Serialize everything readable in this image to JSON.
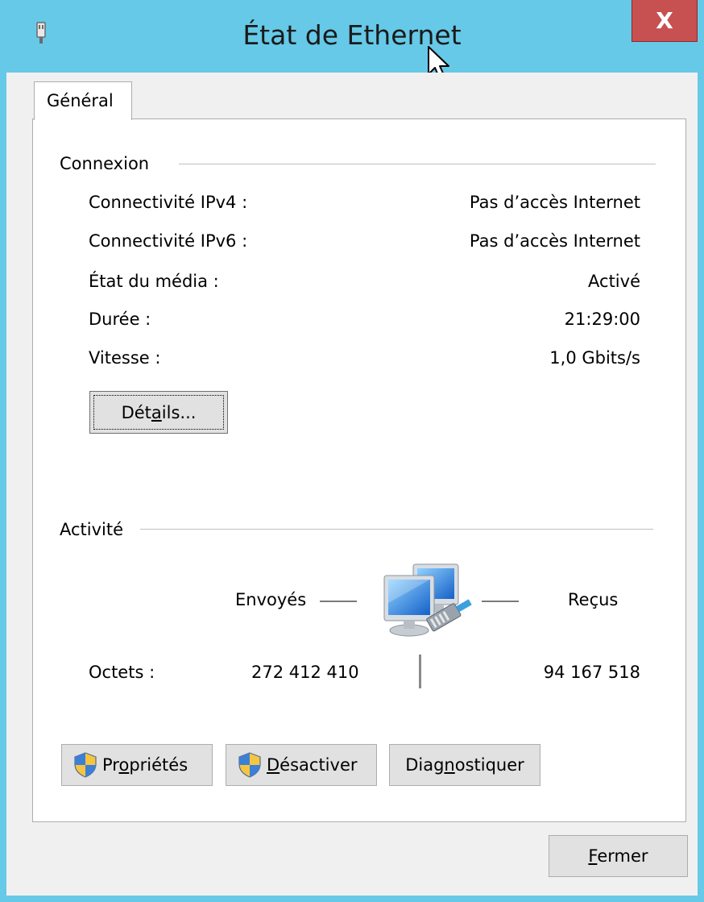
{
  "window": {
    "title": "État de Ethernet",
    "close_glyph": "X"
  },
  "tabs": [
    {
      "label": "Général",
      "selected": true
    }
  ],
  "connexion": {
    "group_label": "Connexion",
    "rows": [
      {
        "label": "Connectivité IPv4 :",
        "value": "Pas d’accès Internet"
      },
      {
        "label": "Connectivité IPv6 :",
        "value": "Pas d’accès Internet"
      },
      {
        "label": "État du média :",
        "value": "Activé"
      },
      {
        "label": "Durée :",
        "value": "21:29:00"
      },
      {
        "label": "Vitesse :",
        "value": "1,0 Gbits/s"
      }
    ],
    "details_button": {
      "before": "Dét",
      "mnemonic": "a",
      "after": "ils..."
    }
  },
  "activite": {
    "group_label": "Activité",
    "sent_label": "Envoyés",
    "received_label": "Reçus",
    "bytes_label": "Octets :",
    "bytes_sent": "272 412 410",
    "bytes_received": "94 167 518",
    "icon": "network-computers-icon"
  },
  "buttons": {
    "proprietes": {
      "before": "Pr",
      "mnemonic": "o",
      "after": "priétés",
      "icon": "uac-shield-icon"
    },
    "desactiver": {
      "before": "",
      "mnemonic": "D",
      "after": "ésactiver",
      "icon": "uac-shield-icon"
    },
    "diagnostiquer": {
      "before": "Diag",
      "mnemonic": "n",
      "after": "ostiquer"
    },
    "fermer": {
      "before": "",
      "mnemonic": "F",
      "after": "ermer"
    }
  },
  "colors": {
    "title_bar": "#66c9e8",
    "close_button": "#c75050",
    "dialog_bg": "#f0f0f0",
    "panel_bg": "#ffffff"
  }
}
